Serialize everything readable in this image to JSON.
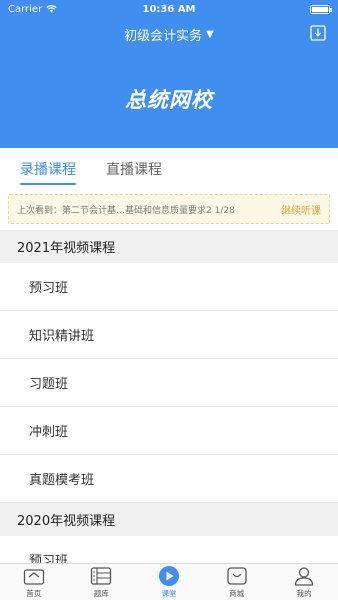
{
  "status_bar": {
    "carrier": "Carrier",
    "time": "10:36 AM"
  },
  "nav": {
    "title": "初级会计实务",
    "title_caret": "▼"
  },
  "banner": {
    "logo_text": "总统网校"
  },
  "tabs": [
    {
      "label": "录播课程",
      "active": true
    },
    {
      "label": "直播课程",
      "active": false
    }
  ],
  "last_watch": {
    "text": "上次看到：第二节会计基…基础和信息质量要求2 1/28",
    "continue_label": "继续听课"
  },
  "sections": [
    {
      "title": "2021年视频课程",
      "items": [
        "预习班",
        "知识精讲班",
        "习题班",
        "冲刺班",
        "真题模考班"
      ]
    },
    {
      "title": "2020年视频课程",
      "items": [
        "预习班"
      ]
    }
  ],
  "tabbar": [
    {
      "label": "首页",
      "icon": "home-icon",
      "active": false
    },
    {
      "label": "题库",
      "icon": "question-bank-icon",
      "active": false
    },
    {
      "label": "课堂",
      "icon": "play-icon",
      "active": true
    },
    {
      "label": "商城",
      "icon": "shop-icon",
      "active": false
    },
    {
      "label": "我的",
      "icon": "profile-icon",
      "active": false
    }
  ],
  "colors": {
    "primary": "#3f8ef0",
    "notice_bg": "#fdf8e6",
    "continue": "#f0a030",
    "section_bg": "#f0f0f0"
  }
}
